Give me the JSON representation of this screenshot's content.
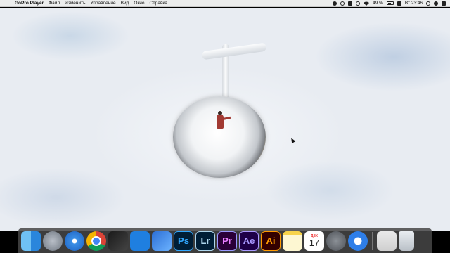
{
  "menubar": {
    "app_name": "GoPro Player",
    "menus": [
      "Файл",
      "Изменить",
      "Управление",
      "Вид",
      "Окно",
      "Справка"
    ],
    "battery": "49 %",
    "clock": "Вт 23:46"
  },
  "dock": {
    "items": [
      {
        "name": "Finder",
        "icon": "finder-icon"
      },
      {
        "name": "Launchpad",
        "icon": "rocket-icon"
      },
      {
        "name": "Safari",
        "icon": "compass-icon"
      },
      {
        "name": "Google Chrome",
        "icon": "chrome-icon"
      },
      {
        "name": "Final Cut Pro",
        "icon": "clapper-icon"
      },
      {
        "name": "Quik",
        "icon": "quik-icon"
      },
      {
        "name": "Quik for Desktop",
        "icon": "quik-desktop-icon"
      },
      {
        "name": "Photoshop",
        "label": "Ps"
      },
      {
        "name": "Lightroom",
        "label": "Lr"
      },
      {
        "name": "Premiere Pro",
        "label": "Pr"
      },
      {
        "name": "After Effects",
        "label": "Ae"
      },
      {
        "name": "Illustrator",
        "label": "Ai"
      },
      {
        "name": "Notes",
        "icon": "notes-icon"
      },
      {
        "name": "Calendar",
        "month": "ДЕК",
        "day": "17"
      },
      {
        "name": "System Preferences",
        "icon": "gear-icon"
      },
      {
        "name": "GoPro Player",
        "icon": "quik-player-icon"
      },
      {
        "name": "Preview",
        "icon": "preview-icon"
      },
      {
        "name": "Trash",
        "icon": "trash-icon"
      }
    ]
  },
  "colors": {
    "menubar_bg": "#eceded",
    "dock_bg": "#464646",
    "sky": "#e6ebf1"
  }
}
